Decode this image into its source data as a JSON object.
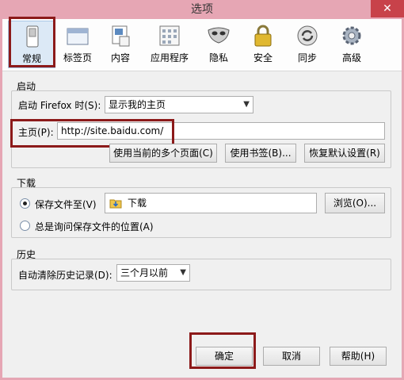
{
  "window": {
    "title": "选项",
    "close_glyph": "✕"
  },
  "toolbar": {
    "items": [
      {
        "label": "常规",
        "icon": "switch-icon"
      },
      {
        "label": "标签页",
        "icon": "window-tabs-icon"
      },
      {
        "label": "内容",
        "icon": "page-icon"
      },
      {
        "label": "应用程序",
        "icon": "calendar-icon"
      },
      {
        "label": "隐私",
        "icon": "mask-icon"
      },
      {
        "label": "安全",
        "icon": "lock-icon"
      },
      {
        "label": "同步",
        "icon": "sync-icon"
      },
      {
        "label": "高级",
        "icon": "gear-icon"
      }
    ]
  },
  "startup": {
    "group_label": "启动",
    "when_label": "启动 Firefox 时(S):",
    "when_value": "显示我的主页",
    "homepage_label": "主页(P):",
    "homepage_value": "http://site.baidu.com/",
    "btn_current": "使用当前的多个页面(C)",
    "btn_bookmark": "使用书签(B)...",
    "btn_default": "恢复默认设置(R)"
  },
  "downloads": {
    "group_label": "下载",
    "save_label": "保存文件至(V)",
    "folder_value": "下载",
    "browse_button": "浏览(O)...",
    "ask_label": "总是询问保存文件的位置(A)"
  },
  "history": {
    "group_label": "历史",
    "clear_label": "自动清除历史记录(D):",
    "clear_value": "三个月以前"
  },
  "footer": {
    "ok_button": "确定",
    "cancel_button": "取消",
    "help_button": "帮助(H)"
  }
}
